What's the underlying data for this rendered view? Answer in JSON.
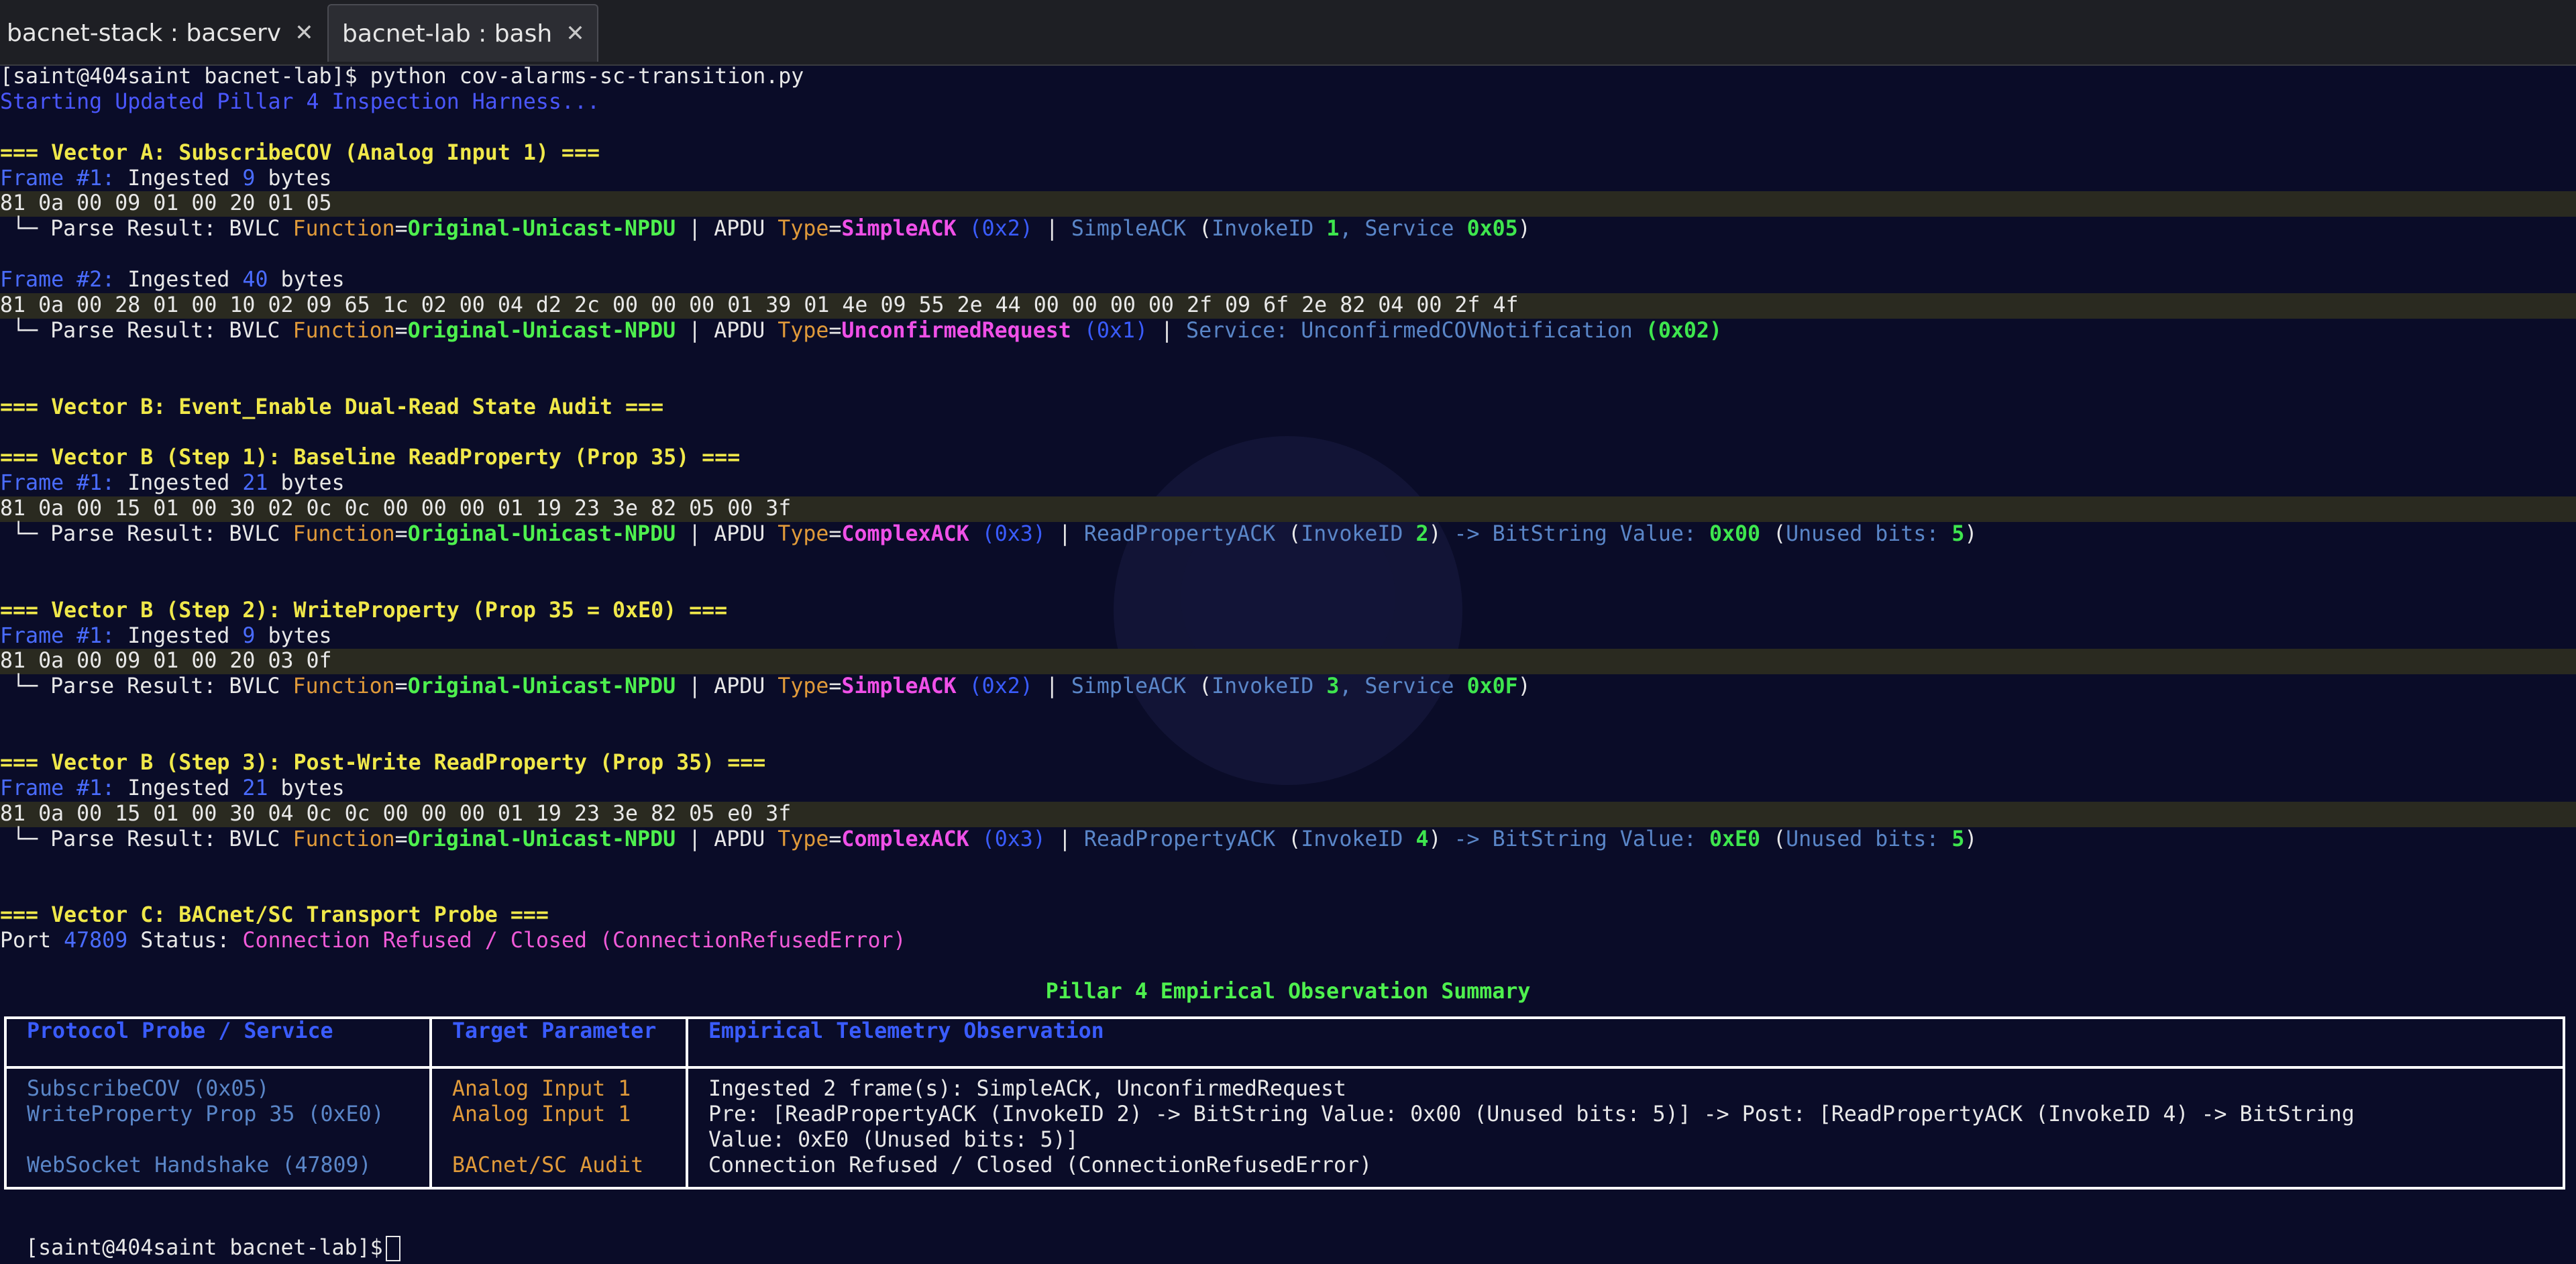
{
  "tabs": [
    {
      "label": "bacnet-stack : bacserv",
      "close": "✕"
    },
    {
      "label": "bacnet-lab : bash",
      "close": "✕"
    }
  ],
  "term": {
    "prompt": "[saint@404saint bacnet-lab]$",
    "command": " python cov-alarms-sc-transition.py",
    "starting": "Starting Updated Pillar 4 Inspection Harness...",
    "vecA": "=== Vector A: SubscribeCOV (Analog Input 1) ===",
    "vecB": "=== Vector B: Event_Enable Dual-Read State Audit ===",
    "vecB1": "=== Vector B (Step 1): Baseline ReadProperty (Prop 35) ===",
    "vecB2": "=== Vector B (Step 2): WriteProperty (Prop 35 = 0xE0) ===",
    "vecB3": "=== Vector B (Step 3): Post-Write ReadProperty (Prop 35) ===",
    "vecC": "=== Vector C: BACnet/SC Transport Probe ===",
    "frame1": "Frame #1:",
    "frame2": "Frame #2:",
    "ingested": " Ingested ",
    "bytes": " bytes",
    "parse_prefix": "└─ Parse Result: BVLC ",
    "function_kw": "Function",
    "eq": "=",
    "ounpdu": "Original-Unicast-NPDU",
    "apdu": " | APDU ",
    "type_kw": "Type",
    "pipe": " | ",
    "simpleack": "SimpleACK",
    "complexack": "ComplexACK",
    "unconfirmed": "UnconfirmedRequest",
    "rpack": "ReadPropertyACK",
    "invokeid": "InvokeID ",
    "service": ", Service ",
    "bitstring": " -> BitString Value: ",
    "unused": "Unused bits: ",
    "open_paren": " (",
    "close_paren": ")",
    "a1_bytes": "9",
    "a1_hex": "81 0a 00 09 01 00 20 01 05",
    "a1_code": "0x2",
    "a1_invoke": "1",
    "a1_service": "0x05",
    "a2_bytes": "40",
    "a2_hex": "81 0a 00 28 01 00 10 02 09 65 1c 02 00 04 d2 2c 00 00 00 01 39 01 4e 09 55 2e 44 00 00 00 00 2f 09 6f 2e 82 04 00 2f 4f",
    "a2_code": "0x1",
    "a2_service_label": "Service: UnconfirmedCOVNotification",
    "a2_service_code": "(0x02)",
    "b1_bytes": "21",
    "b1_hex": "81 0a 00 15 01 00 30 02 0c 0c 00 00 00 01 19 23 3e 82 05 00 3f",
    "b1_code": "0x3",
    "b1_invoke": "2",
    "b1_value": "0x00",
    "b1_unused": "5",
    "b2_bytes": "9",
    "b2_hex": "81 0a 00 09 01 00 20 03 0f",
    "b2_code": "0x2",
    "b2_invoke": "3",
    "b2_service": "0x0F",
    "b3_bytes": "21",
    "b3_hex": "81 0a 00 15 01 00 30 04 0c 0c 00 00 00 01 19 23 3e 82 05 e0 3f",
    "b3_code": "0x3",
    "b3_invoke": "4",
    "b3_value": "0xE0",
    "b3_unused": "5",
    "port_label": "Port ",
    "port": "47809",
    "status_label": " Status: ",
    "status": "Connection Refused / Closed (ConnectionRefusedError)"
  },
  "summary": {
    "title": "Pillar 4 Empirical Observation Summary",
    "headers": [
      "Protocol Probe / Service",
      "Target Parameter",
      "Empirical Telemetry Observation"
    ],
    "rows": [
      [
        "SubscribeCOV (0x05)",
        "Analog Input 1",
        "Ingested 2 frame(s): SimpleACK, UnconfirmedRequest"
      ],
      [
        "WriteProperty Prop 35 (0xE0)",
        "Analog Input 1",
        "Pre: [ReadPropertyACK (InvokeID 2) -> BitString Value: 0x00 (Unused bits: 5)] -> Post: [ReadPropertyACK (InvokeID 4) -> BitString",
        "Value: 0xE0 (Unused bits: 5)]"
      ],
      [
        "WebSocket Handshake (47809)",
        "BACnet/SC Audit",
        "Connection Refused / Closed (ConnectionRefusedError)"
      ]
    ]
  },
  "final_prompt": "[saint@404saint bacnet-lab]$"
}
